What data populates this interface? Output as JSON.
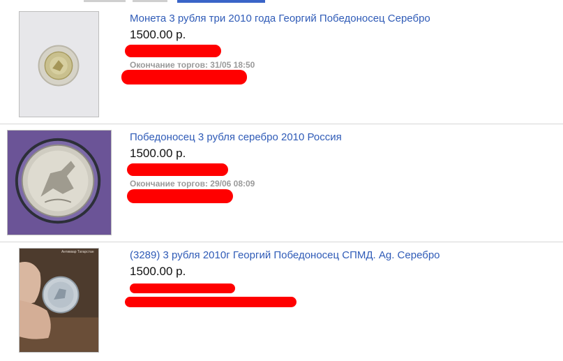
{
  "listings": [
    {
      "title": "Монета 3 рубля три 2010 года Георгий Победоносец Серебро",
      "price": "1500.00 р.",
      "ends": "Окончание торгов: 31/05 18:50",
      "image": "coin-in-capsule-photo"
    },
    {
      "title": "Победоносец 3 рубля серебро 2010 Россия",
      "price": "1500.00 р.",
      "ends": "Окончание торгов: 29/06 08:09",
      "image": "coin-on-purple-photo"
    },
    {
      "title": "(3289) 3 рубля 2010г Георгий Победоносец СПМД. Ag. Серебро",
      "price": "1500.00 р.",
      "image": "coin-in-hand-photo",
      "watermark": "Антиквар Татарстан"
    }
  ],
  "colors": {
    "link": "#2f5bb7",
    "price": "#111111",
    "meta": "#9a9a9a",
    "redaction": "#ff0000",
    "separator": "#d6d6d6"
  }
}
